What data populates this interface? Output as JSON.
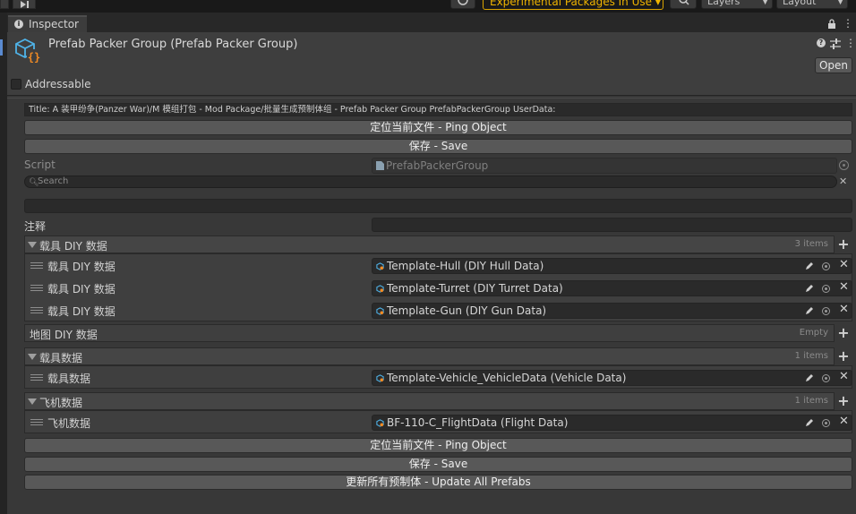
{
  "toolbar": {
    "experimental_warning": "Experimental Packages In Use ▾",
    "layers": "Layers",
    "layout": "Layout"
  },
  "tab": {
    "title": "Inspector"
  },
  "header": {
    "asset_title": "Prefab Packer Group (Prefab Packer Group)",
    "open_label": "Open",
    "addressable_label": "Addressable",
    "addressable_checked": false
  },
  "body": {
    "title_text": "Title: A 装甲纷争(Panzer War)/M 模组打包 - Mod Package/批量生成预制体组 - Prefab Packer Group PrefabPackerGroup UserData:",
    "ping_label": "定位当前文件 - Ping Object",
    "save_label": "保存 - Save",
    "script_label": "Script",
    "script_value": "PrefabPackerGroup",
    "search_placeholder": "Search",
    "note_label": "注释",
    "note_value": "",
    "groups": {
      "diy": {
        "title": "载具 DIY 数据",
        "count": "3 items",
        "items": [
          {
            "label": "载具 DIY 数据",
            "value": "Template-Hull (DIY Hull Data)"
          },
          {
            "label": "载具 DIY 数据",
            "value": "Template-Turret (DIY Turret Data)"
          },
          {
            "label": "载具 DIY 数据",
            "value": "Template-Gun (DIY Gun Data)"
          }
        ]
      },
      "map_diy": {
        "title": "地图 DIY 数据",
        "count": "Empty"
      },
      "vehicle": {
        "title": "载具数据",
        "count": "1 items",
        "items": [
          {
            "label": "载具数据",
            "value": "Template-Vehicle_VehicleData (Vehicle Data)"
          }
        ]
      },
      "flight": {
        "title": "飞机数据",
        "count": "1 items",
        "items": [
          {
            "label": "飞机数据",
            "value": "BF-110-C_FlightData (Flight Data)"
          }
        ]
      }
    },
    "footer_ping_label": "定位当前文件 - Ping Object",
    "footer_save_label": "保存 - Save",
    "update_all_label": "更新所有预制体 - Update All Prefabs"
  },
  "icon_colors": {
    "asset_icon": "#4fb3e8",
    "braces": "#f08a24",
    "warning": "#f0b400"
  }
}
